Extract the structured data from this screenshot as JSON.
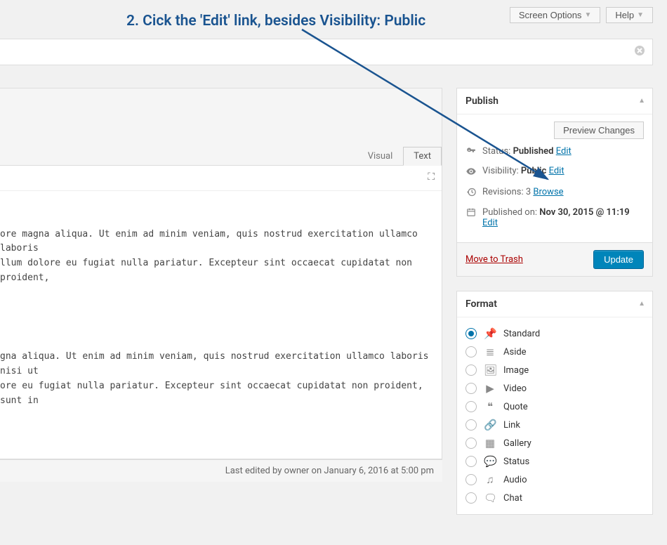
{
  "annotation": "2. Cick the 'Edit' link, besides Visibility: Public",
  "top": {
    "screen_options": "Screen Options",
    "help": "Help"
  },
  "editor": {
    "tab_visual": "Visual",
    "tab_text": "Text",
    "body_line1": "ore magna aliqua. Ut enim ad minim veniam, quis nostrud exercitation ullamco laboris",
    "body_line2": "llum dolore eu fugiat nulla pariatur. Excepteur sint occaecat cupidatat non proident,",
    "body_line3": "gna aliqua. Ut enim ad minim veniam, quis nostrud exercitation ullamco laboris nisi ut",
    "body_line4": "ore eu fugiat nulla pariatur. Excepteur sint occaecat cupidatat non proident, sunt in",
    "footer": "Last edited by owner on January 6, 2016 at 5:00 pm"
  },
  "publish": {
    "title": "Publish",
    "preview_btn": "Preview Changes",
    "status_label": "Status:",
    "status_value": "Published",
    "visibility_label": "Visibility:",
    "visibility_value": "Public",
    "revisions_label": "Revisions:",
    "revisions_value": "3",
    "browse": "Browse",
    "published_label": "Published on:",
    "published_value": "Nov 30, 2015 @ 11:19",
    "edit": "Edit",
    "trash": "Move to Trash",
    "update": "Update"
  },
  "format": {
    "title": "Format",
    "items": [
      {
        "label": "Standard",
        "checked": true,
        "icon": "📌"
      },
      {
        "label": "Aside",
        "checked": false,
        "icon": "≣"
      },
      {
        "label": "Image",
        "checked": false,
        "icon": "🖼"
      },
      {
        "label": "Video",
        "checked": false,
        "icon": "▶"
      },
      {
        "label": "Quote",
        "checked": false,
        "icon": "❝"
      },
      {
        "label": "Link",
        "checked": false,
        "icon": "🔗"
      },
      {
        "label": "Gallery",
        "checked": false,
        "icon": "▦"
      },
      {
        "label": "Status",
        "checked": false,
        "icon": "💬"
      },
      {
        "label": "Audio",
        "checked": false,
        "icon": "♫"
      },
      {
        "label": "Chat",
        "checked": false,
        "icon": "🗨"
      }
    ]
  }
}
